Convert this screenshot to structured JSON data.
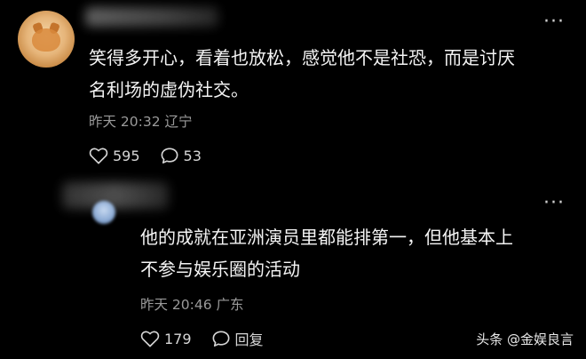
{
  "comments": [
    {
      "text_line1": "笑得多开心，看着也放松，感觉他不是社恐，而是讨厌",
      "text_line2": "名利场的虚伪社交。",
      "time": "昨天 20:32",
      "location": "辽宁",
      "likes": "595",
      "replies": "53",
      "like_icon": "heart-outline-icon",
      "reply_icon": "speech-bubble-icon",
      "more_icon": "more-dots-icon"
    },
    {
      "text_line1": "他的成就在亚洲演员里都能排第一，但他基本上",
      "text_line2": "不参与娱乐圈的活动",
      "time": "昨天 20:46",
      "location": "广东",
      "likes": "179",
      "reply_label": "回复",
      "like_icon": "heart-outline-icon",
      "reply_icon": "speech-bubble-icon",
      "more_icon": "more-dots-icon"
    }
  ],
  "watermark": {
    "text": "头条 @金娱良言"
  },
  "colors": {
    "background": "#000000",
    "text": "#f4f4f4",
    "meta": "#9a9a9a"
  }
}
